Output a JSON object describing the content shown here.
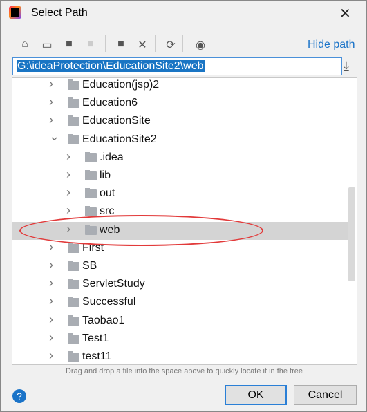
{
  "window": {
    "title": "Select Path",
    "close": "✕"
  },
  "toolbar": {
    "hide_path": "Hide path",
    "icons": [
      "home-icon",
      "desktop-icon",
      "project-folder-icon",
      "module-folder-icon",
      "new-folder-icon",
      "delete-icon",
      "refresh-icon",
      "show-hidden-icon"
    ]
  },
  "path_input": {
    "value": "G:\\ideaProtection\\EducationSite2\\web"
  },
  "tree": {
    "rows": [
      {
        "label": "Education(jsp)2",
        "level": 1,
        "expanded": false
      },
      {
        "label": "Education6",
        "level": 1,
        "expanded": false
      },
      {
        "label": "EducationSite",
        "level": 1,
        "expanded": false
      },
      {
        "label": "EducationSite2",
        "level": 1,
        "expanded": true
      },
      {
        "label": ".idea",
        "level": 2,
        "expanded": false
      },
      {
        "label": "lib",
        "level": 2,
        "expanded": false
      },
      {
        "label": "out",
        "level": 2,
        "expanded": false
      },
      {
        "label": "src",
        "level": 2,
        "expanded": false
      },
      {
        "label": "web",
        "level": 2,
        "expanded": false,
        "selected": true
      },
      {
        "label": "First",
        "level": 1,
        "expanded": false
      },
      {
        "label": "SB",
        "level": 1,
        "expanded": false
      },
      {
        "label": "ServletStudy",
        "level": 1,
        "expanded": false
      },
      {
        "label": "Successful",
        "level": 1,
        "expanded": false
      },
      {
        "label": "Taobao1",
        "level": 1,
        "expanded": false
      },
      {
        "label": "Test1",
        "level": 1,
        "expanded": false
      },
      {
        "label": "test11",
        "level": 1,
        "expanded": false
      }
    ]
  },
  "hint": "Drag and drop a file into the space above to quickly locate it in the tree",
  "buttons": {
    "help": "?",
    "ok": "OK",
    "cancel": "Cancel"
  },
  "colors": {
    "accent": "#1a73c8",
    "selection": "#1a75c4",
    "annotation": "#e23a3a"
  }
}
